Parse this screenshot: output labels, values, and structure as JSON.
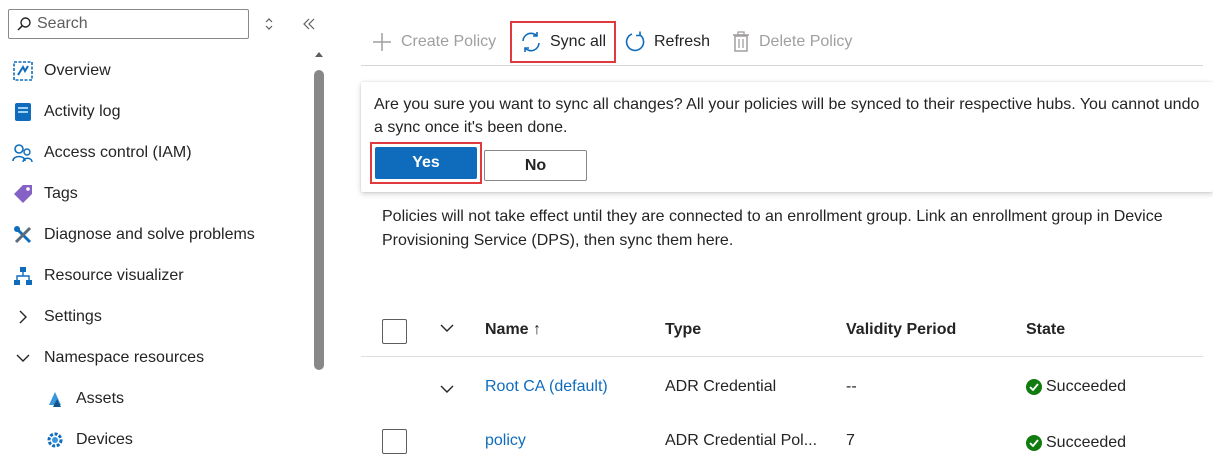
{
  "sidebar": {
    "search_placeholder": "Search",
    "items": [
      {
        "label": "Overview",
        "icon": "overview-icon"
      },
      {
        "label": "Activity log",
        "icon": "activity-log-icon"
      },
      {
        "label": "Access control (IAM)",
        "icon": "people-icon"
      },
      {
        "label": "Tags",
        "icon": "tag-icon"
      },
      {
        "label": "Diagnose and solve problems",
        "icon": "wrench-icon"
      },
      {
        "label": "Resource visualizer",
        "icon": "hierarchy-icon"
      },
      {
        "label": "Settings",
        "icon": "chevron-right-icon"
      },
      {
        "label": "Namespace resources",
        "icon": "chevron-down-icon"
      },
      {
        "label": "Assets",
        "icon": "assets-icon"
      },
      {
        "label": "Devices",
        "icon": "gear-icon"
      }
    ]
  },
  "toolbar": {
    "create_policy": "Create Policy",
    "sync_all": "Sync all",
    "refresh": "Refresh",
    "delete_policy": "Delete Policy"
  },
  "dialog": {
    "message": "Are you sure you want to sync all changes? All your policies will be synced to their respective hubs. You cannot undo a sync once it's been done.",
    "yes_label": "Yes",
    "no_label": "No"
  },
  "info_text": "Policies will not take effect until they are connected to an enrollment group. Link an enrollment group in Device Provisioning Service (DPS), then sync them here.",
  "table": {
    "columns": {
      "name": "Name ↑",
      "type": "Type",
      "validity": "Validity Period",
      "state": "State"
    },
    "rows": [
      {
        "name": "Root CA (default)",
        "type": "ADR Credential",
        "validity": "--",
        "state": "Succeeded"
      },
      {
        "name": "policy",
        "type": "ADR Credential Pol...",
        "validity": "7",
        "state": "Succeeded"
      }
    ]
  },
  "colors": {
    "accent": "#0f6cbd",
    "highlight": "#e0393e",
    "success": "#107c10"
  }
}
